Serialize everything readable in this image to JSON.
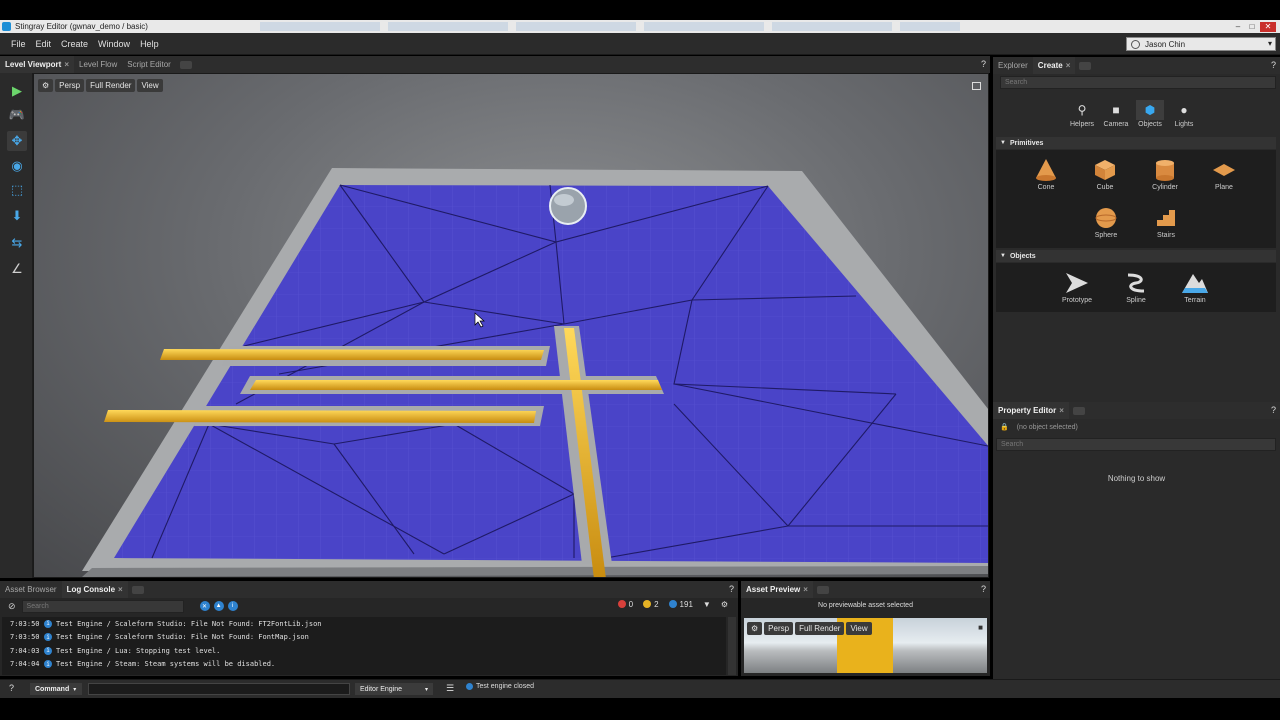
{
  "window": {
    "title": "Stingray Editor (gwnav_demo / basic)",
    "controls": {
      "minimize": "–",
      "maximize": "□",
      "close": "✕"
    }
  },
  "menu": [
    "File",
    "Edit",
    "Create",
    "Window",
    "Help"
  ],
  "user": {
    "name": "Jason Chin"
  },
  "main_tabs": [
    {
      "label": "Level Viewport",
      "close": "×"
    },
    {
      "label": "Level Flow"
    },
    {
      "label": "Script Editor"
    }
  ],
  "help_glyph": "?",
  "viewport": {
    "toolbar": [
      "Persp",
      "Full Render",
      "View"
    ]
  },
  "right_tabs": [
    {
      "label": "Explorer"
    },
    {
      "label": "Create",
      "close": "×"
    }
  ],
  "create_panel": {
    "search_placeholder": "Search",
    "categories": [
      "Helpers",
      "Camera",
      "Objects",
      "Lights"
    ],
    "primitives_title": "Primitives",
    "primitives": [
      "Cone",
      "Cube",
      "Cylinder",
      "Plane",
      "Sphere",
      "Stairs"
    ],
    "objects_title": "Objects",
    "objects": [
      "Prototype",
      "Spline",
      "Terrain"
    ]
  },
  "property_editor": {
    "tab": "Property Editor",
    "close": "×",
    "selection": "(no object selected)",
    "search_placeholder": "Search",
    "empty_message": "Nothing to show"
  },
  "bottom_tabs": [
    {
      "label": "Asset Browser"
    },
    {
      "label": "Log Console",
      "close": "×"
    }
  ],
  "log_console": {
    "search_placeholder": "Search",
    "counts": {
      "errors": "0",
      "warnings": "2",
      "info": "191"
    },
    "lines": [
      {
        "time": "7:03:50",
        "text": "Test Engine / Scaleform Studio: File Not Found: FT2FontLib.json"
      },
      {
        "time": "7:03:50",
        "text": "Test Engine / Scaleform Studio: File Not Found: FontMap.json"
      },
      {
        "time": "7:04:03",
        "text": "Test Engine / Lua: Stopping test level."
      },
      {
        "time": "7:04:04",
        "text": "Test Engine / Steam: Steam systems will be disabled."
      }
    ]
  },
  "asset_preview": {
    "tab": "Asset Preview",
    "close": "×",
    "message": "No previewable asset selected",
    "toolbar": [
      "Persp",
      "Full Render",
      "View"
    ]
  },
  "statusbar": {
    "command_label": "Command",
    "engine_label": "Editor Engine",
    "message": "Test engine closed"
  },
  "colors": {
    "navmesh": "#4a44c8",
    "gold": "#f2c12e",
    "accent": "#2f83cf"
  }
}
